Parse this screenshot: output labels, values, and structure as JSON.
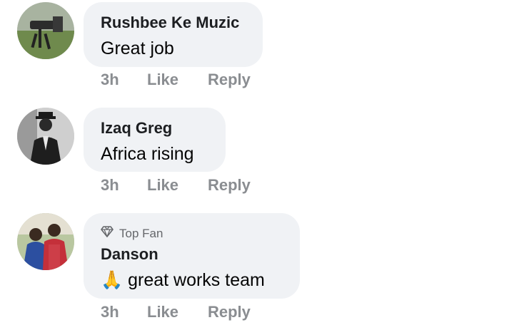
{
  "comments": [
    {
      "author": "Rushbee Ke Muzic",
      "text": "Great job",
      "time": "3h",
      "like": "Like",
      "reply": "Reply",
      "avatar": "camera-rig-avatar"
    },
    {
      "author": "Izaq Greg",
      "text": "Africa rising",
      "time": "3h",
      "like": "Like",
      "reply": "Reply",
      "avatar": "man-in-hat-avatar"
    },
    {
      "author": "Danson",
      "badge": "Top Fan",
      "text": "great works team",
      "emoji": "🙏",
      "time": "3h",
      "like": "Like",
      "reply": "Reply",
      "avatar": "two-people-avatar"
    }
  ],
  "colors": {
    "bubble": "#f0f2f5",
    "action_text": "#8a8d91",
    "badge_text": "#65676b"
  }
}
